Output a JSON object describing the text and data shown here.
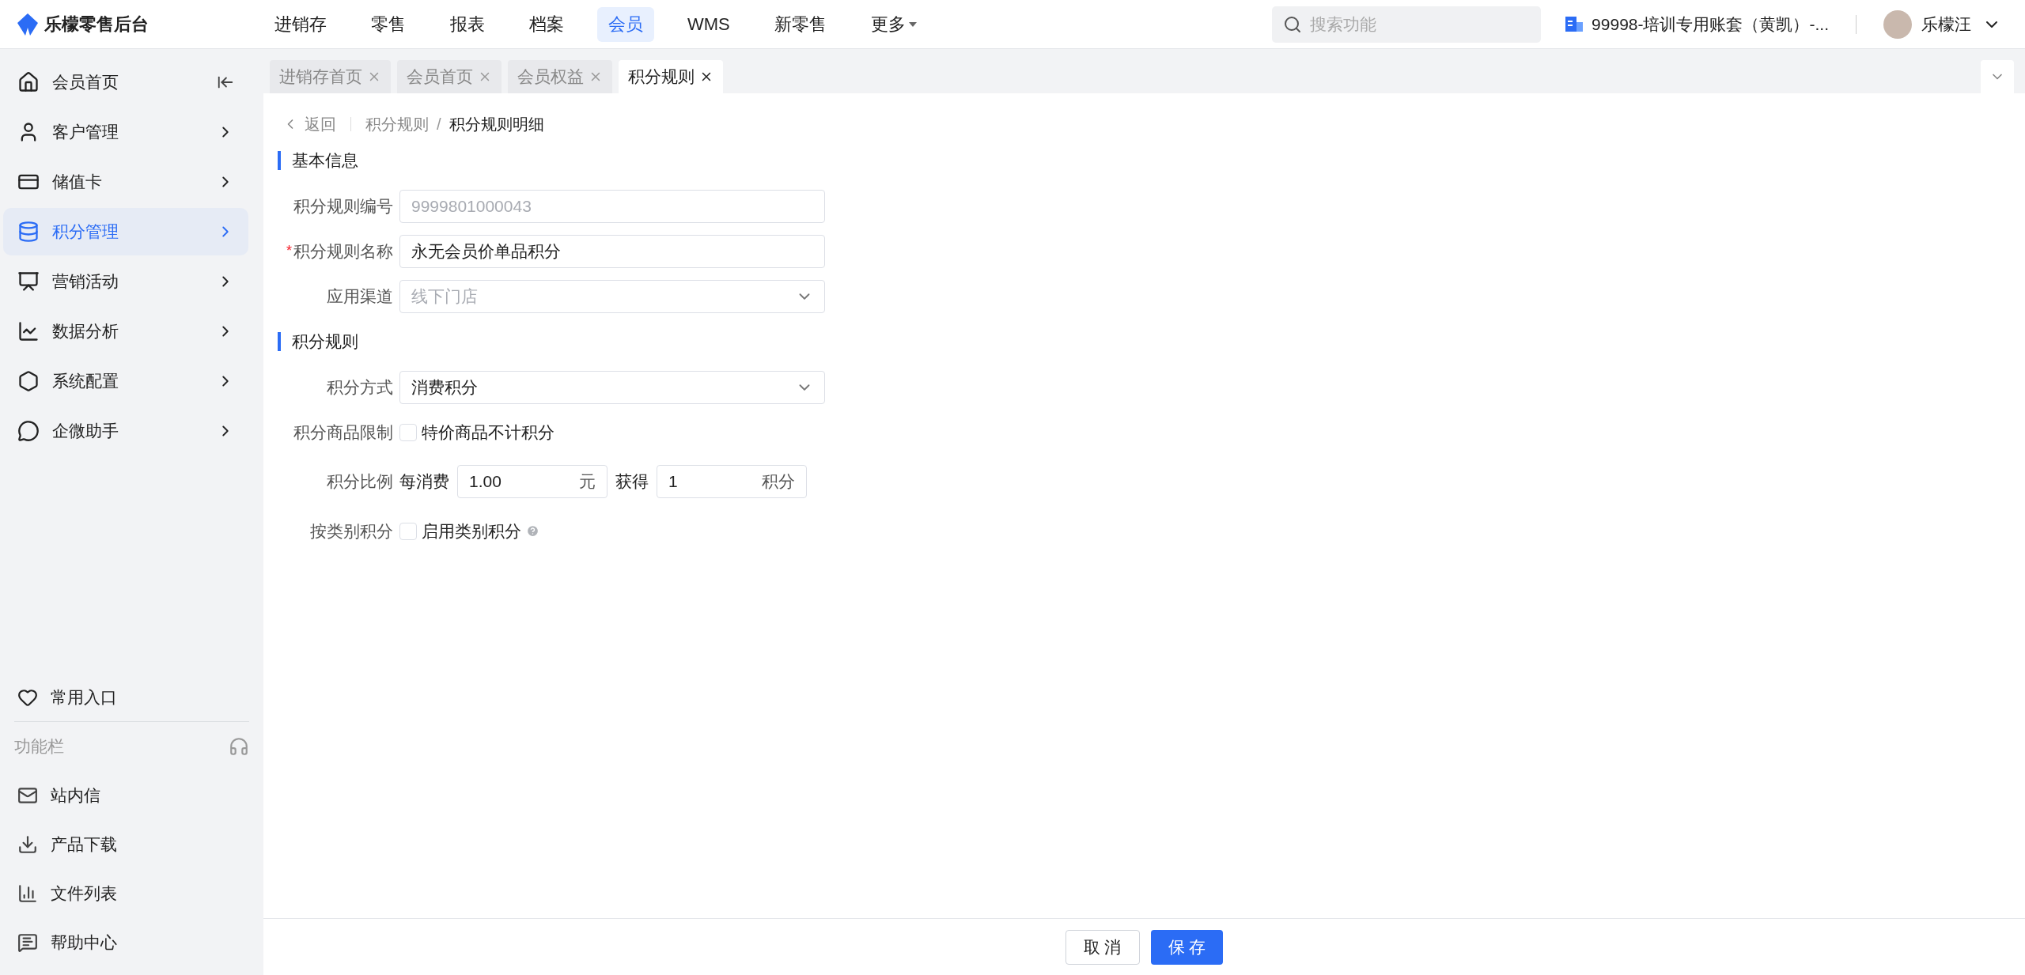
{
  "app": {
    "title": "乐檬零售后台"
  },
  "top_nav": [
    {
      "label": "进销存",
      "selected": false,
      "kind": "link"
    },
    {
      "label": "零售",
      "selected": false,
      "kind": "link"
    },
    {
      "label": "报表",
      "selected": false,
      "kind": "link"
    },
    {
      "label": "档案",
      "selected": false,
      "kind": "link"
    },
    {
      "label": "会员",
      "selected": true,
      "kind": "link"
    },
    {
      "label": "WMS",
      "selected": false,
      "kind": "link"
    },
    {
      "label": "新零售",
      "selected": false,
      "kind": "link"
    },
    {
      "label": "更多",
      "selected": false,
      "kind": "menu"
    }
  ],
  "search": {
    "placeholder": "搜索功能"
  },
  "account": {
    "label": "99998-培训专用账套（黄凯）-..."
  },
  "user": {
    "name": "乐檬汪"
  },
  "sidebar": {
    "items": [
      {
        "label": "会员首页",
        "selected": false,
        "kind": "collapse"
      },
      {
        "label": "客户管理",
        "selected": false,
        "kind": "expand"
      },
      {
        "label": "储值卡",
        "selected": false,
        "kind": "expand"
      },
      {
        "label": "积分管理",
        "selected": true,
        "kind": "expand"
      },
      {
        "label": "营销活动",
        "selected": false,
        "kind": "expand"
      },
      {
        "label": "数据分析",
        "selected": false,
        "kind": "expand"
      },
      {
        "label": "系统配置",
        "selected": false,
        "kind": "expand"
      },
      {
        "label": "企微助手",
        "selected": false,
        "kind": "expand"
      }
    ],
    "favorites": "常用入口",
    "toolbar_title": "功能栏",
    "tools": [
      "站内信",
      "产品下载",
      "文件列表",
      "帮助中心"
    ]
  },
  "tabs": [
    {
      "label": "进销存首页",
      "selected": false
    },
    {
      "label": "会员首页",
      "selected": false
    },
    {
      "label": "会员权益",
      "selected": false
    },
    {
      "label": "积分规则",
      "selected": true
    }
  ],
  "breadcrumb": {
    "back": "返回",
    "separator": "/",
    "path": [
      "积分规则",
      "积分规则明细"
    ]
  },
  "required_mark": "*",
  "sections": [
    {
      "title": "基本信息",
      "fields": [
        {
          "kind": "input",
          "label": "积分规则编号",
          "value": "9999801000043",
          "disabled": true,
          "required": false
        },
        {
          "kind": "input",
          "label": "积分规则名称",
          "value": "永无会员价单品积分",
          "disabled": false,
          "required": true
        },
        {
          "kind": "select",
          "label": "应用渠道",
          "value": "线下门店",
          "disabled": true,
          "required": false
        }
      ]
    },
    {
      "title": "积分规则",
      "fields": [
        {
          "kind": "select",
          "label": "积分方式",
          "value": "消费积分",
          "disabled": false,
          "required": false
        },
        {
          "kind": "checkbox",
          "label": "积分商品限制",
          "option": "特价商品不计积分",
          "checked": false,
          "help": false
        },
        {
          "kind": "ratio",
          "label": "积分比例",
          "spend_label": "每消费",
          "spend_value": "1.00",
          "spend_unit": "元",
          "earn_label": "获得",
          "earn_value": "1",
          "earn_unit": "积分"
        },
        {
          "kind": "checkbox",
          "label": "按类别积分",
          "option": "启用类别积分",
          "checked": false,
          "help": true
        }
      ]
    }
  ],
  "footer": {
    "cancel": "取 消",
    "save": "保 存"
  }
}
